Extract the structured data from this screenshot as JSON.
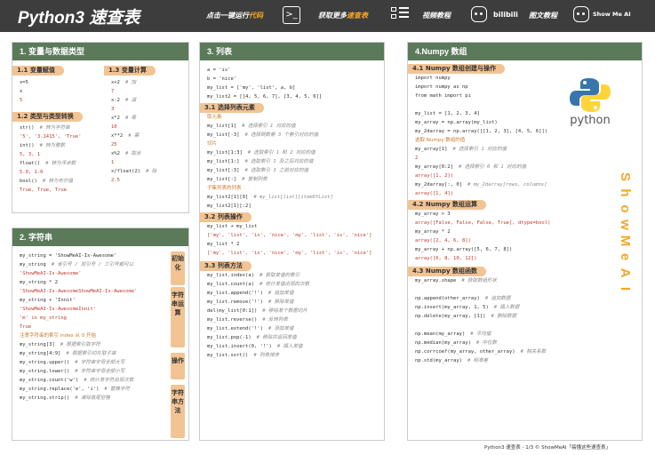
{
  "header": {
    "title": "Python3 速查表",
    "run_pre": "点击一键运行",
    "run_hl": "代码",
    "more_pre": "获取更多",
    "more_hl": "速查表",
    "video": "视频教程",
    "bili": "bilibili",
    "graphic": "图文教程",
    "brand": "Show Me AI"
  },
  "col1": {
    "title": "1. 变量与数据类型",
    "s11": "1.1 变量赋值",
    "s13": "1.3 变量计算",
    "s12": "1.2 类型与类型转换",
    "assign": [
      "x=5",
      "x",
      "5"
    ],
    "calc": [
      [
        "x+2",
        "# 加"
      ],
      [
        "7",
        ""
      ],
      [
        "x-2",
        "# 减"
      ],
      [
        "3",
        ""
      ],
      [
        "x*2",
        "# 乘"
      ],
      [
        "10",
        ""
      ],
      [
        "x**2",
        "# 幂"
      ],
      [
        "25",
        ""
      ],
      [
        "x%2",
        "# 取余"
      ],
      [
        "1",
        ""
      ],
      [
        "x/float(2)",
        "# 除"
      ],
      [
        "2.5",
        ""
      ]
    ],
    "types": [
      [
        "str()",
        "# 转为字符串"
      ],
      [
        "'5', '3.1415', 'True'",
        ""
      ],
      [
        "int()",
        "# 转为整数"
      ],
      [
        "5, 3, 1",
        ""
      ],
      [
        "float()",
        "# 转为浮点数"
      ],
      [
        "5.0, 1.0",
        ""
      ],
      [
        "bool()",
        "# 转为布尔值"
      ],
      [
        "True, True, True",
        ""
      ]
    ]
  },
  "col2": {
    "title": "2. 字符串",
    "side": [
      "初始化",
      "字符串运算",
      "操作",
      "字符串方法"
    ],
    "lines": [
      [
        "my_string = 'ShowMeAI-Is-Awesome'",
        ""
      ],
      [
        "my_string",
        "# 省引号 / 双引号 / 三引号都可以"
      ],
      [
        "'ShowMeAI-Is-Awesome'",
        ""
      ],
      [
        "my_string * 2",
        ""
      ],
      [
        "'ShowMeAI-Is-AwesomeShowMeAI-Is-Awesome'",
        ""
      ],
      [
        "my_string + 'Innit'",
        ""
      ],
      [
        "'ShowMeAI-Is-AwesomeInnit'",
        ""
      ],
      [
        "'m' in my_string",
        ""
      ],
      [
        "True",
        ""
      ],
      [
        "注意字符串的索引 index 从 0 开始",
        ""
      ],
      [
        "my_string[3]",
        "# 根据索引取字符"
      ],
      [
        "my_string[4:9]",
        "# 根据索引切片取子串"
      ],
      [
        "my_string.upper()",
        "# 字符串字母全部大写"
      ],
      [
        "my_string.lower()",
        "# 字符串字母全部小写"
      ],
      [
        "my_string.count('w')",
        "# 统计某字符出现次数"
      ],
      [
        "my_string.replace('e', 'i')",
        "# 替换字符"
      ],
      [
        "my_string.strip()",
        "# 清除首尾空格"
      ]
    ]
  },
  "col3": {
    "title": "3. 列表",
    "s31": "3.1 选择列表元素",
    "s32": "3.2 列表操作",
    "s33": "3.3 列表方法",
    "top": [
      "a = 'is'",
      "b = 'nice'",
      "my_list = ['my', 'list', a, b]",
      "my_list2 = [[4, 5, 6, 7], [3, 4, 5, 6]]"
    ],
    "sel": [
      [
        "取元素",
        ""
      ],
      [
        "my_list[1]",
        "# 选择索引 1 对应的值"
      ],
      [
        "my_list[-3]",
        "# 选择倒数第 3 个索引对应的值"
      ],
      [
        "切片",
        ""
      ],
      [
        "my_list[1:3]",
        "# 选取索引 1 和 2 对应的值"
      ],
      [
        "my_list[1:]",
        "# 选取索引 1 及之后对应的值"
      ],
      [
        "my_list[:3]",
        "# 选取索引 3 之前对应的值"
      ],
      [
        "my_list[:]",
        "# 复制列表"
      ],
      [
        "子集列表的列表",
        ""
      ],
      [
        "my_list2[1][0]",
        "# my_list[list][itemOfList]"
      ],
      [
        "my_list2[1][:2]",
        ""
      ]
    ],
    "ops": [
      "my_list + my_list",
      "['my', 'list', 'is', 'nice', 'my', 'list', 'is', 'nice']",
      "my_list * 2",
      "['my', 'list', 'is', 'nice', 'my', 'list', 'is', 'nice']"
    ],
    "meth": [
      [
        "my_list.index(a)",
        "# 获取某值的索引"
      ],
      [
        "my_list.count(a)",
        "# 统计某值出现的次数"
      ],
      [
        "my_list.append('!')",
        "# 追加某值"
      ],
      [
        "my_list.remove('!')",
        "# 移除某值"
      ],
      [
        "del(my_list[0:1])",
        "# 移除某个数据切片"
      ],
      [
        "my_list.reverse()",
        "# 反转列表"
      ],
      [
        "my_list.extend('!')",
        "# 添加某值"
      ],
      [
        "my_list.pop(-1)",
        "# 移除并返回某值"
      ],
      [
        "my_list.insert(0, '!')",
        "# 插入某值"
      ],
      [
        "my_list.sort()",
        "# 列表排序"
      ]
    ]
  },
  "col4": {
    "title": "4.Numpy 数组",
    "s41": "4.1 Numpy 数组创建与操作",
    "s42": "4.2 Numpy 数组运算",
    "s43": "4.3 Numpy 数组函数",
    "logo": "python",
    "vertical": "ShowMeAI",
    "create": [
      [
        "import numpy",
        ""
      ],
      [
        "import numpy as np",
        ""
      ],
      [
        "from math import pi",
        ""
      ],
      [
        "",
        ""
      ],
      [
        "my_list = [1, 2, 3, 4]",
        ""
      ],
      [
        "my_array = np.array(my_list)",
        ""
      ],
      [
        "my_2darray = np.array([[1, 2, 3], [4, 5, 6]])",
        ""
      ],
      [
        "选取 Numpy 数组的值",
        ""
      ],
      [
        "my_array[1]",
        "# 选择索引 1 对应的值"
      ],
      [
        "2",
        ""
      ],
      [
        "my_array[0:2]",
        "# 选择索引 0 和 1 对应的值"
      ],
      [
        "array([1, 2])",
        ""
      ],
      [
        "my_2darray[:, 0]",
        "# my_2darray[rows, columns]"
      ],
      [
        "array([1, 4])",
        ""
      ]
    ],
    "ops": [
      [
        "my_array > 3",
        ""
      ],
      [
        "array([False, False, False, True], dtype=bool)",
        ""
      ],
      [
        "my_array * 2",
        ""
      ],
      [
        "array([2, 4, 6, 8])",
        ""
      ],
      [
        "my_array + np.array([5, 6, 7, 8])",
        ""
      ],
      [
        "array([6, 8, 10, 12])",
        ""
      ]
    ],
    "funcs": [
      [
        "my_array.shape",
        "# 获取数组形状"
      ],
      [
        "",
        ""
      ],
      [
        "np.append(other_array)",
        "# 追加数据"
      ],
      [
        "np.insert(my_array, 1, 5)",
        "# 插入数据"
      ],
      [
        "np.delete(my_array, [1])",
        "# 删除数据"
      ],
      [
        "",
        ""
      ],
      [
        "np.mean(my_array)",
        "# 平均值"
      ],
      [
        "np.median(my_array)",
        "# 中位数"
      ],
      [
        "np.corrcoef(my_array, other_array)",
        "# 相关系数"
      ],
      [
        "np.std(my_array)",
        "# 标准差"
      ]
    ]
  },
  "footer": "Python3 速查表 - 1/3  © ShowMeAI「搞懂这些速查表」"
}
